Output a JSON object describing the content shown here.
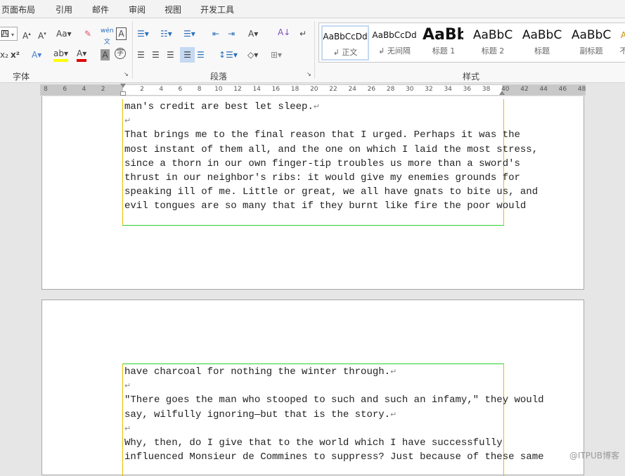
{
  "menu": [
    "页面布局",
    "引用",
    "邮件",
    "审阅",
    "视图",
    "开发工具"
  ],
  "font_size_value": "四",
  "groups": {
    "font": "字体",
    "paragraph": "段落",
    "styles": "样式"
  },
  "styles": [
    {
      "preview": "AaBbCcDd",
      "label": "↲ 正文"
    },
    {
      "preview": "AaBbCcDd",
      "label": "↲ 无间隔"
    },
    {
      "preview": "AaBb",
      "label": "标题 1"
    },
    {
      "preview": "AaBbC",
      "label": "标题 2"
    },
    {
      "preview": "AaBbC",
      "label": "标题"
    },
    {
      "preview": "AaBbC",
      "label": "副标题"
    },
    {
      "preview": "A",
      "label": "不"
    }
  ],
  "ruler": [
    "8",
    "6",
    "4",
    "2",
    "2",
    "4",
    "6",
    "8",
    "10",
    "12",
    "14",
    "16",
    "18",
    "20",
    "22",
    "24",
    "26",
    "28",
    "30",
    "32",
    "34",
    "36",
    "38",
    "40",
    "42",
    "44",
    "46",
    "48"
  ],
  "page1_lines": [
    {
      "t": "man's credit are best let sleep.",
      "j": false,
      "pm": true
    },
    {
      "t": "",
      "j": false,
      "pm": true
    },
    {
      "t": "That brings me to the final reason that I urged. Perhaps it was the",
      "j": true
    },
    {
      "t": "most instant of them all, and the one on which I laid the most stress,",
      "j": true
    },
    {
      "t": "since a thorn in our own finger-tip troubles us more than a sword's",
      "j": true
    },
    {
      "t": "thrust in our neighbor's ribs: it would give my enemies grounds for",
      "j": true
    },
    {
      "t": "speaking ill of me. Little or great, we all have gnats to bite us, and",
      "j": true
    },
    {
      "t": "evil tongues are so many that if they burnt like fire the poor would",
      "j": true
    }
  ],
  "page2_lines": [
    {
      "t": "have charcoal for nothing the winter through.",
      "j": false,
      "pm": true
    },
    {
      "t": "",
      "j": false,
      "pm": true
    },
    {
      "t": "\"There goes the man who stooped to such and such an infamy,\" they would",
      "j": true
    },
    {
      "t": "say, wilfully ignoring—but that is the story.",
      "j": false,
      "pm": true
    },
    {
      "t": "",
      "j": false,
      "pm": true
    },
    {
      "t": "Why, then, do I give that to the world which I have successfully",
      "j": true
    },
    {
      "t": "influenced Monsieur de Commines to suppress? Just because of these same",
      "j": true
    }
  ],
  "watermark": "@ITPUB博客"
}
